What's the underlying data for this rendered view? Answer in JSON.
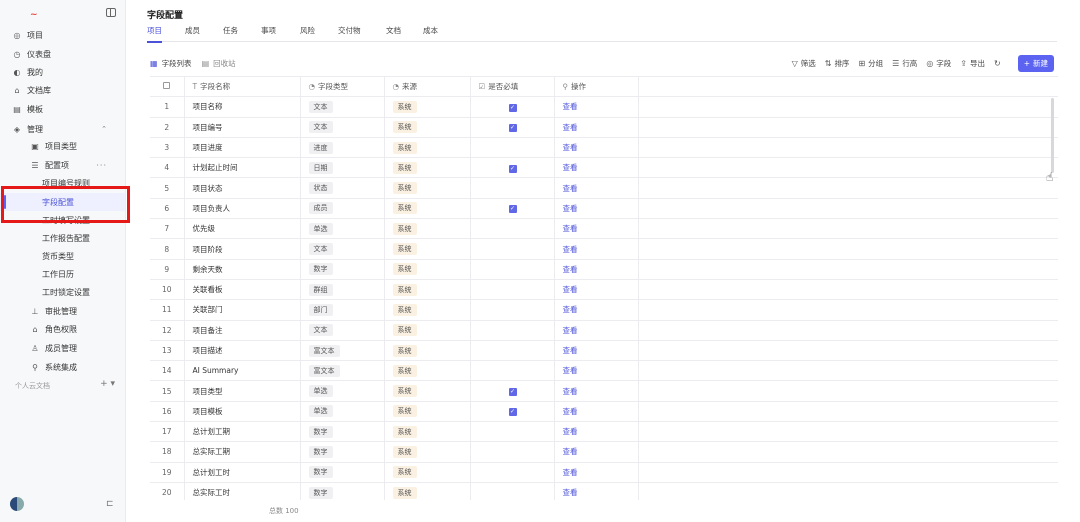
{
  "app": {
    "logo": "~"
  },
  "sidebar": {
    "items": [
      {
        "label": "项目",
        "icon": "project-icon",
        "glyph": "◎"
      },
      {
        "label": "仪表盘",
        "icon": "dashboard-icon",
        "glyph": "◷"
      },
      {
        "label": "我的",
        "icon": "my-icon",
        "glyph": "◐"
      },
      {
        "label": "文档库",
        "icon": "docs-icon",
        "glyph": "⌂"
      },
      {
        "label": "模板",
        "icon": "template-icon",
        "glyph": "▤"
      },
      {
        "label": "管理",
        "icon": "manage-icon",
        "glyph": "◈"
      },
      {
        "label": "项目类型",
        "icon": "project-type-icon",
        "glyph": "▣"
      },
      {
        "label": "配置项",
        "icon": "config-icon",
        "glyph": "☰"
      },
      {
        "label": "项目编号规则"
      },
      {
        "label": "字段配置"
      },
      {
        "label": "工时填写设置"
      },
      {
        "label": "工作报告配置"
      },
      {
        "label": "货币类型"
      },
      {
        "label": "工作日历"
      },
      {
        "label": "工时锁定设置"
      },
      {
        "label": "审批管理",
        "icon": "approval-icon",
        "glyph": "⊥"
      },
      {
        "label": "角色权限",
        "icon": "role-icon",
        "glyph": "⌂"
      },
      {
        "label": "成员管理",
        "icon": "member-icon",
        "glyph": "♙"
      },
      {
        "label": "系统集成",
        "icon": "integration-icon",
        "glyph": "⚲"
      }
    ],
    "personal_docs": "个人云文档",
    "personal_actions": "+ ▾"
  },
  "header": {
    "title": "字段配置",
    "tabs": [
      "项目",
      "成员",
      "任务",
      "事项",
      "风险",
      "交付物",
      "文档",
      "成本"
    ]
  },
  "subtabs": {
    "field_list": "字段列表",
    "recycle_bin": "回收站"
  },
  "actions": {
    "filter": "筛选",
    "sort": "排序",
    "group": "分组",
    "row_height": "行高",
    "fields": "字段",
    "export": "导出",
    "new": "新建"
  },
  "table": {
    "columns": [
      "字段名称",
      "字段类型",
      "来源",
      "是否必填",
      "操作"
    ],
    "rows": [
      {
        "n": "1",
        "name": "项目名称",
        "type": "文本",
        "source": "系统",
        "required": true,
        "op": "查看"
      },
      {
        "n": "2",
        "name": "项目编号",
        "type": "文本",
        "source": "系统",
        "required": true,
        "op": "查看"
      },
      {
        "n": "3",
        "name": "项目进度",
        "type": "进度",
        "source": "系统",
        "required": false,
        "op": "查看"
      },
      {
        "n": "4",
        "name": "计划起止时间",
        "type": "日期",
        "source": "系统",
        "required": true,
        "op": "查看"
      },
      {
        "n": "5",
        "name": "项目状态",
        "type": "状态",
        "source": "系统",
        "required": false,
        "op": "查看"
      },
      {
        "n": "6",
        "name": "项目负责人",
        "type": "成员",
        "source": "系统",
        "required": true,
        "op": "查看"
      },
      {
        "n": "7",
        "name": "优先级",
        "type": "单选",
        "source": "系统",
        "required": false,
        "op": "查看"
      },
      {
        "n": "8",
        "name": "项目阶段",
        "type": "文本",
        "source": "系统",
        "required": false,
        "op": "查看"
      },
      {
        "n": "9",
        "name": "剩余天数",
        "type": "数字",
        "source": "系统",
        "required": false,
        "op": "查看"
      },
      {
        "n": "10",
        "name": "关联看板",
        "type": "群组",
        "source": "系统",
        "required": false,
        "op": "查看"
      },
      {
        "n": "11",
        "name": "关联部门",
        "type": "部门",
        "source": "系统",
        "required": false,
        "op": "查看"
      },
      {
        "n": "12",
        "name": "项目备注",
        "type": "文本",
        "source": "系统",
        "required": false,
        "op": "查看"
      },
      {
        "n": "13",
        "name": "项目描述",
        "type": "富文本",
        "source": "系统",
        "required": false,
        "op": "查看"
      },
      {
        "n": "14",
        "name": "AI Summary",
        "type": "富文本",
        "source": "系统",
        "required": false,
        "op": "查看"
      },
      {
        "n": "15",
        "name": "项目类型",
        "type": "单选",
        "source": "系统",
        "required": true,
        "op": "查看"
      },
      {
        "n": "16",
        "name": "项目模板",
        "type": "单选",
        "source": "系统",
        "required": true,
        "op": "查看"
      },
      {
        "n": "17",
        "name": "总计划工期",
        "type": "数字",
        "source": "系统",
        "required": false,
        "op": "查看"
      },
      {
        "n": "18",
        "name": "总实际工期",
        "type": "数字",
        "source": "系统",
        "required": false,
        "op": "查看"
      },
      {
        "n": "19",
        "name": "总计划工时",
        "type": "数字",
        "source": "系统",
        "required": false,
        "op": "查看"
      },
      {
        "n": "20",
        "name": "总实际工时",
        "type": "数字",
        "source": "系统",
        "required": false,
        "op": "查看"
      }
    ],
    "total": "总数 100"
  },
  "colors": {
    "accent": "#5b63f0",
    "highlight": "#e61919",
    "source_tag": "#fbf1e2"
  }
}
